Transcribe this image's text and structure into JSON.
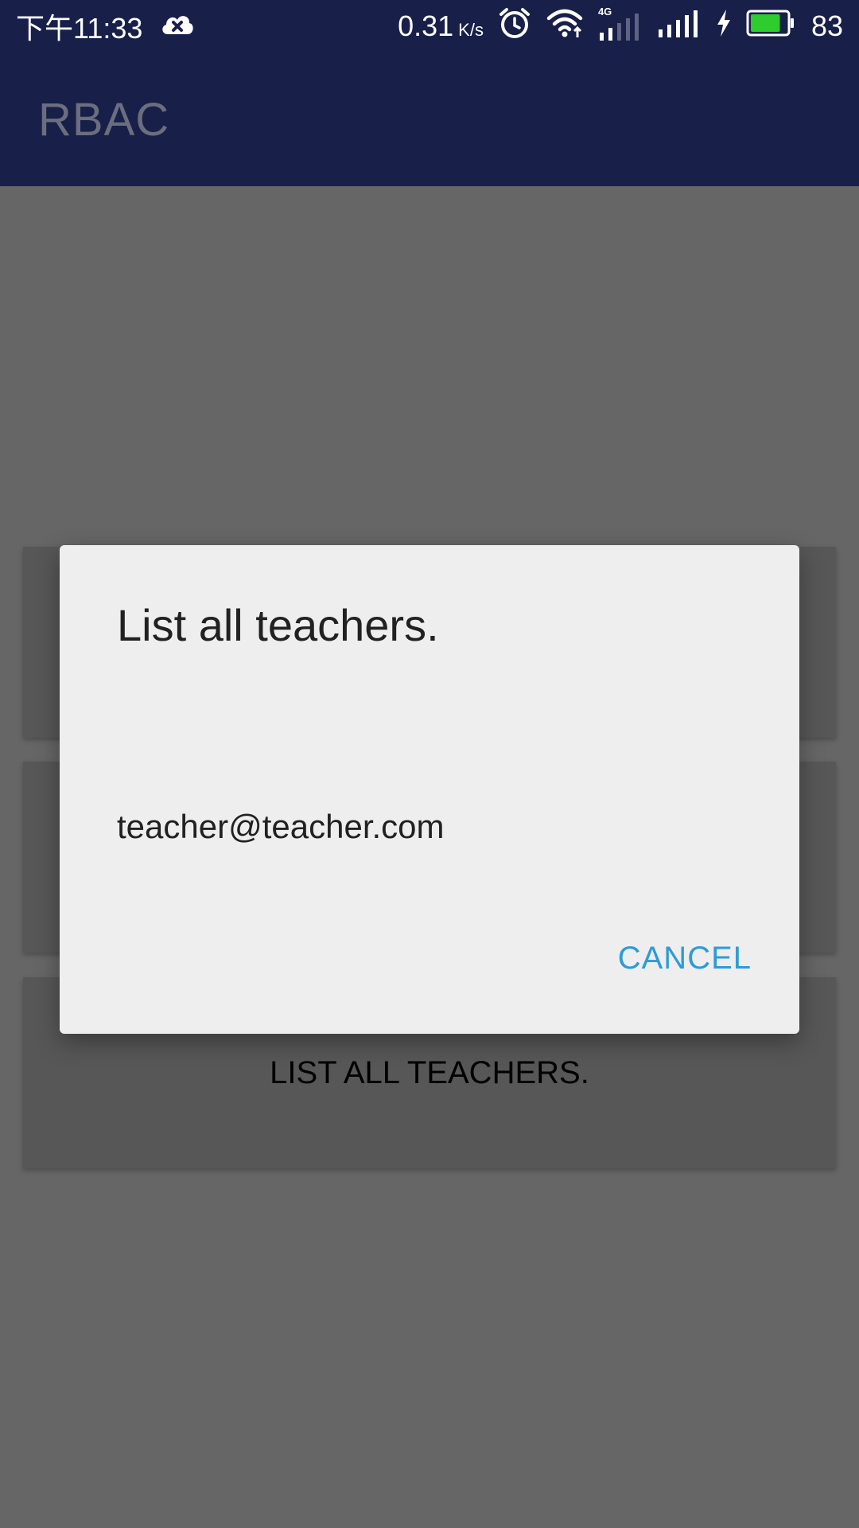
{
  "status_bar": {
    "time": "下午11:33",
    "net_speed_value": "0.31",
    "net_speed_unit": "K/s",
    "network_type": "4G",
    "battery_percent": "83",
    "battery_level": 0.83,
    "battery_color": "#2ecc2e"
  },
  "app_bar": {
    "title": "RBAC",
    "background": "#181f48"
  },
  "cards": {
    "third_label": "LIST ALL TEACHERS."
  },
  "dialog": {
    "title": "List all teachers.",
    "items": [
      "teacher@teacher.com"
    ],
    "cancel_label": "CANCEL",
    "accent_color": "#2e9bd6"
  }
}
